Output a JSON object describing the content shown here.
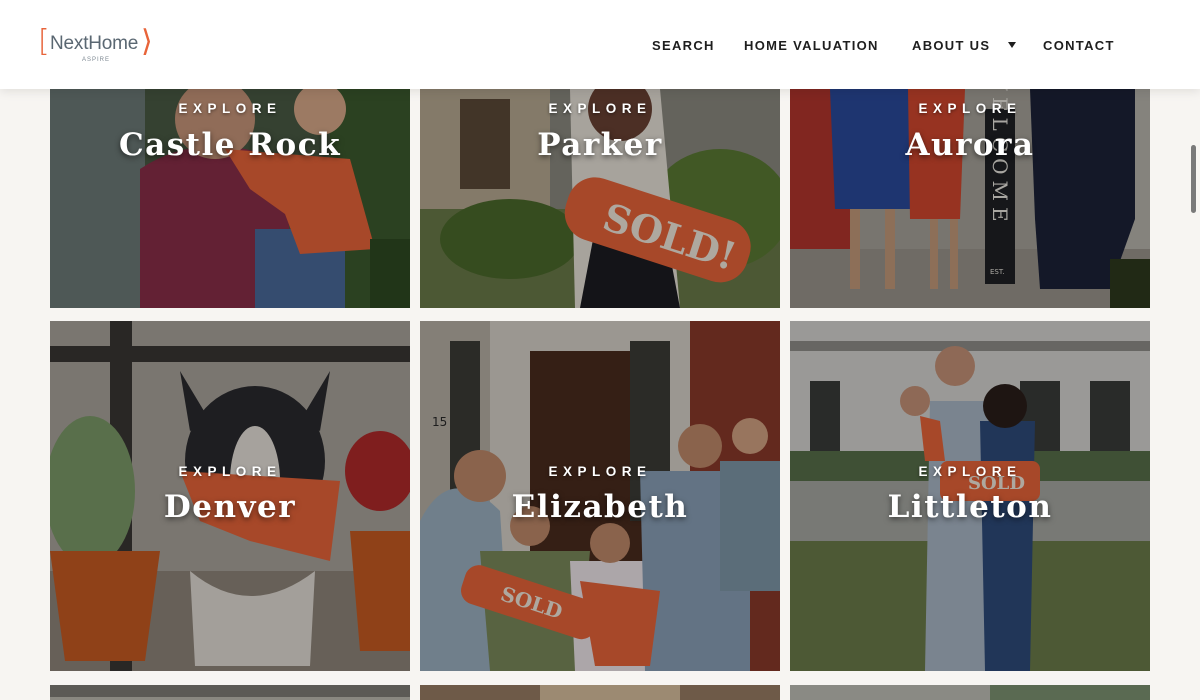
{
  "header": {
    "logo": {
      "brand": "NextHome",
      "sub": "ASPIRE",
      "bracket_left": "[",
      "bracket_right": "⟩",
      "accent_color": "#e8643a"
    },
    "nav": {
      "search": "SEARCH",
      "valuation": "HOME VALUATION",
      "about": "ABOUT US",
      "contact": "CONTACT"
    }
  },
  "tiles": [
    {
      "explore": "EXPLORE",
      "city": "Castle Rock"
    },
    {
      "explore": "EXPLORE",
      "city": "Parker"
    },
    {
      "explore": "EXPLORE",
      "city": "Aurora"
    },
    {
      "explore": "EXPLORE",
      "city": "Denver"
    },
    {
      "explore": "EXPLORE",
      "city": "Elizabeth"
    },
    {
      "explore": "EXPLORE",
      "city": "Littleton"
    }
  ],
  "photo_text": {
    "sold_sign": "SOLD!",
    "sold_small": "SOLD",
    "welcome": "WELCOME",
    "house_number": "15",
    "est": "EST."
  },
  "colors": {
    "brand_orange": "#e8643a",
    "page_bg": "#f7f5f2"
  }
}
